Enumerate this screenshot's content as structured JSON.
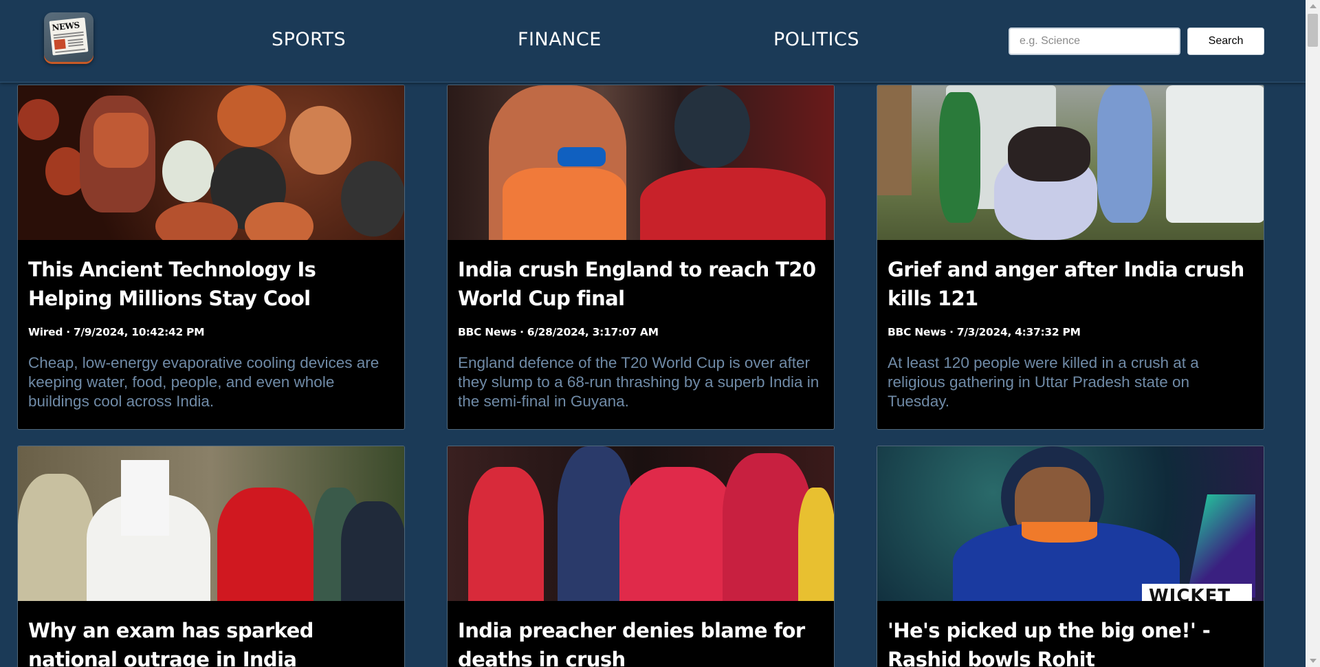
{
  "header": {
    "nav": [
      {
        "label": "SPORTS"
      },
      {
        "label": "FINANCE"
      },
      {
        "label": "POLITICS"
      }
    ],
    "search": {
      "placeholder": "e.g. Science",
      "button_label": "Search"
    },
    "logo_text": "NEWS"
  },
  "articles": [
    {
      "title": "This Ancient Technology Is Helping Millions Stay Cool",
      "meta": "Wired · 7/9/2024, 10:42:42 PM",
      "description": "Cheap, low-energy evaporative cooling devices are keeping water, food, people, and even whole buildings cool across India."
    },
    {
      "title": "India crush England to reach T20 World Cup final",
      "meta": "BBC News · 6/28/2024, 3:17:07 AM",
      "description": "England defence of the T20 World Cup is over after they slump to a 68-run thrashing by a superb India in the semi-final in Guyana."
    },
    {
      "title": "Grief and anger after India crush kills 121",
      "meta": "BBC News · 7/3/2024, 4:37:32 PM",
      "description": "At least 120 people were killed in a crush at a religious gathering in Uttar Pradesh state on Tuesday."
    },
    {
      "title": "Why an exam has sparked national outrage in India",
      "meta": "",
      "description": ""
    },
    {
      "title": "India preacher denies blame for deaths in crush",
      "meta": "",
      "description": ""
    },
    {
      "title": "'He's picked up the big one!' - Rashid bowls Rohit",
      "meta": "",
      "description": ""
    }
  ],
  "image_overlay_text": "WICKET",
  "colors": {
    "background": "#1b3a57",
    "card": "#000000",
    "description": "#6f8aa6",
    "accent": "#c85a26"
  }
}
